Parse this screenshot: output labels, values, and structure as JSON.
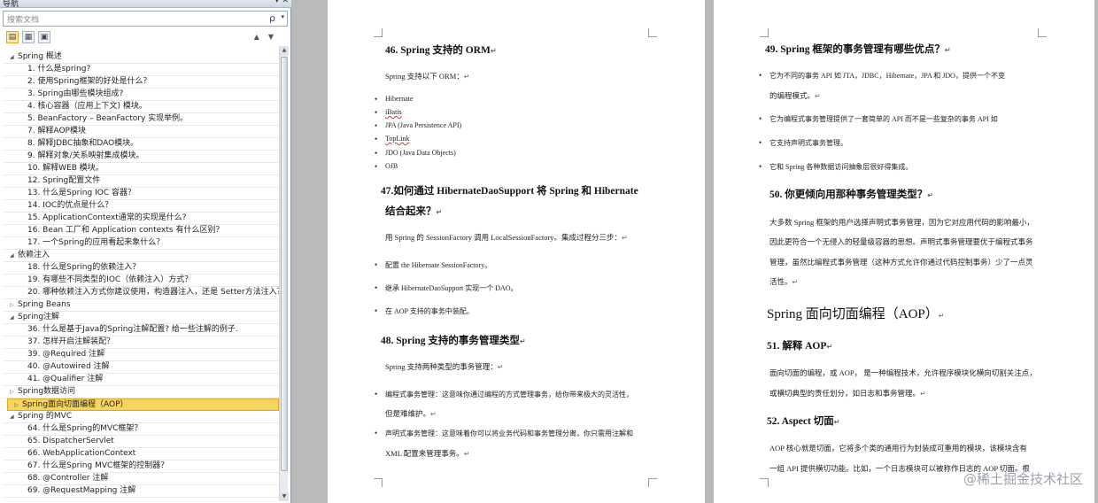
{
  "nav": {
    "title": "导航",
    "pin": "▾",
    "close": "✕",
    "search_placeholder": "搜索文档",
    "search_icon": "ρ",
    "search_dropdown": "▾",
    "tabs": [
      "headings-view",
      "pages-view",
      "results-view"
    ],
    "arrows": "▲▼",
    "tree": [
      {
        "level": 0,
        "label": "Spring 概述",
        "expanded": true
      },
      {
        "level": 1,
        "label": "1. 什么是spring?"
      },
      {
        "level": 1,
        "label": "2. 使用Spring框架的好处是什么？"
      },
      {
        "level": 1,
        "label": "3. Spring由哪些模块组成?"
      },
      {
        "level": 1,
        "label": "4. 核心容器（应用上下文) 模块。"
      },
      {
        "level": 1,
        "label": "5. BeanFactory – BeanFactory 实现举例。"
      },
      {
        "level": 1,
        "label": "7. 解释AOP模块"
      },
      {
        "level": 1,
        "label": "8. 解释JDBC抽象和DAO模块。"
      },
      {
        "level": 1,
        "label": "9. 解释对象/关系映射集成模块。"
      },
      {
        "level": 1,
        "label": "10. 解释WEB 模块。"
      },
      {
        "level": 1,
        "label": "12. Spring配置文件"
      },
      {
        "level": 1,
        "label": "13. 什么是Spring IOC 容器？"
      },
      {
        "level": 1,
        "label": "14. IOC的优点是什么？"
      },
      {
        "level": 1,
        "label": "15. ApplicationContext通常的实现是什么?"
      },
      {
        "level": 1,
        "label": "16. Bean 工厂和 Application contexts 有什么区别？"
      },
      {
        "level": 1,
        "label": "17. 一个Spring的应用看起来象什么？"
      },
      {
        "level": 0,
        "label": "依赖注入",
        "expanded": true
      },
      {
        "level": 1,
        "label": "18. 什么是Spring的依赖注入？"
      },
      {
        "level": 1,
        "label": "19. 有哪些不同类型的IOC（依赖注入）方式？"
      },
      {
        "level": 1,
        "label": "20. 哪种依赖注入方式你建议使用，构造器注入，还是 Setter方法注入？"
      },
      {
        "level": 0,
        "label": "Spring Beans",
        "expanded": false
      },
      {
        "level": 0,
        "label": "Spring注解",
        "expanded": true
      },
      {
        "level": 1,
        "label": "36. 什么是基于Java的Spring注解配置? 给一些注解的例子."
      },
      {
        "level": 1,
        "label": "37. 怎样开启注解装配？"
      },
      {
        "level": 1,
        "label": "39. @Required 注解"
      },
      {
        "level": 1,
        "label": "40. @Autowired 注解"
      },
      {
        "level": 1,
        "label": "41. @Qualifier 注解"
      },
      {
        "level": 0,
        "label": "Spring数据访问",
        "expanded": false
      },
      {
        "level": 0,
        "label": "Spring面向切面编程（AOP）",
        "expanded": false,
        "selected": true
      },
      {
        "level": 0,
        "label": "Spring 的MVC",
        "expanded": true
      },
      {
        "level": 1,
        "label": "64. 什么是Spring的MVC框架？"
      },
      {
        "level": 1,
        "label": "65. DispatcherServlet"
      },
      {
        "level": 1,
        "label": "66. WebApplicationContext"
      },
      {
        "level": 1,
        "label": "67. 什么是Spring MVC框架的控制器？"
      },
      {
        "level": 1,
        "label": "68. @Controller 注解"
      },
      {
        "level": 1,
        "label": "69. @RequestMapping 注解"
      }
    ]
  },
  "page1": {
    "h46": "46. Spring 支持的 ORM",
    "p46": "Spring 支持以下 ORM：",
    "orm": [
      "Hibernate",
      "iBatis",
      "JPA (Java Persistence API)",
      "TopLink",
      "JDO (Java Data Objects)",
      "OJB"
    ],
    "h47a": "47.如何通过 HibernateDaoSupport 将 Spring 和 Hibernate",
    "h47b": "结合起来？",
    "p47": "用 Spring 的  SessionFactory  调用  LocalSessionFactory。集成过程分三步：",
    "steps": [
      "配置 the Hibernate SessionFactory。",
      "继承 HibernateDaoSupport 实现一个 DAO。",
      "在 AOP 支持的事务中装配。"
    ],
    "h48": "48. Spring 支持的事务管理类型",
    "p48": "Spring 支持两种类型的事务管理：",
    "t1a": "编程式事务管理：这意味你通过编程的方式管理事务，给你带来极大的灵活性，",
    "t1b": "但是难维护。",
    "t2a": "声明式事务管理：这意味着你可以将业务代码和事务管理分离，你只需用注解和",
    "t2b": "XML 配置来管理事务。",
    "mark": "↵"
  },
  "page2": {
    "h49": "49. Spring 框架的事务管理有哪些优点？",
    "b1a": "它为不同的事务 API 如  JTA，JDBC，Hibernate，JPA 和 JDO，提供一个不变",
    "b1b": "的编程模式。",
    "b2": "它为编程式事务管理提供了一套简单的 API 而不是一些复杂的事务 API 如",
    "b3": "它支持声明式事务管理。",
    "b4": "它和 Spring 各种数据访问抽象层很好得集成。",
    "h50": "50.  你更倾向用那种事务管理类型？",
    "p50a": "大多数 Spring 框架的用户选择声明式事务管理，因为它对应用代码的影响最小，",
    "p50b": "因此更符合一个无侵入的轻量级容器的思想。声明式事务管理要优于编程式事务",
    "p50c": "管理，虽然比编程式事务管理（这种方式允许你通过代码控制事务）少了一点灵",
    "p50d": "活性。",
    "h1": "Spring 面向切面编程（AOP）",
    "h51": "51.  解释 AOP",
    "p51a": "面向切面的编程，或 AOP， 是一种编程技术，允许程序模块化横向切割关注点，",
    "p51b": "或横切典型的责任划分，如日志和事务管理。",
    "h52": "52. Aspect  切面",
    "p52a": "AOP 核心就是切面，它将多个类的通用行为封装成可重用的模块，该模块含有",
    "p52b": "一组 API 提供横切功能。比如，一个日志模块可以被称作日志的 AOP 切面。根",
    "mark": "↵"
  },
  "watermark": "@稀土掘金技术社区"
}
